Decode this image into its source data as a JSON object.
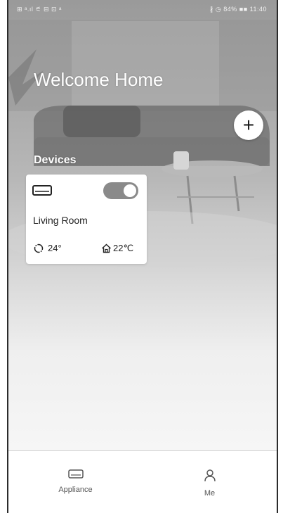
{
  "status_bar": {
    "left_text": "⊞ ᵃ.ıl ⚟ ⊟ ⊡ ᵃ",
    "right_text": "∦ ◷ 84% ■■ 11:40"
  },
  "header": {
    "title": "Welcome Home"
  },
  "add_button": {
    "symbol": "+"
  },
  "devices": {
    "title": "Devices",
    "items": [
      {
        "icon": "air-conditioner-icon",
        "name": "Living Room",
        "power_on": true,
        "set_temperature": "24°",
        "mode_icon": "auto-mode-icon",
        "indoor_icon": "home-icon",
        "indoor_temperature": "22℃"
      }
    ]
  },
  "tabbar": {
    "tabs": [
      {
        "label": "Appliance",
        "icon": "appliance-icon",
        "active": true
      },
      {
        "label": "Me",
        "icon": "person-icon",
        "active": false
      }
    ]
  },
  "colors": {
    "card_bg": "#ffffff",
    "toggle_on": "#8a8a8a",
    "tab_text": "#555555"
  }
}
